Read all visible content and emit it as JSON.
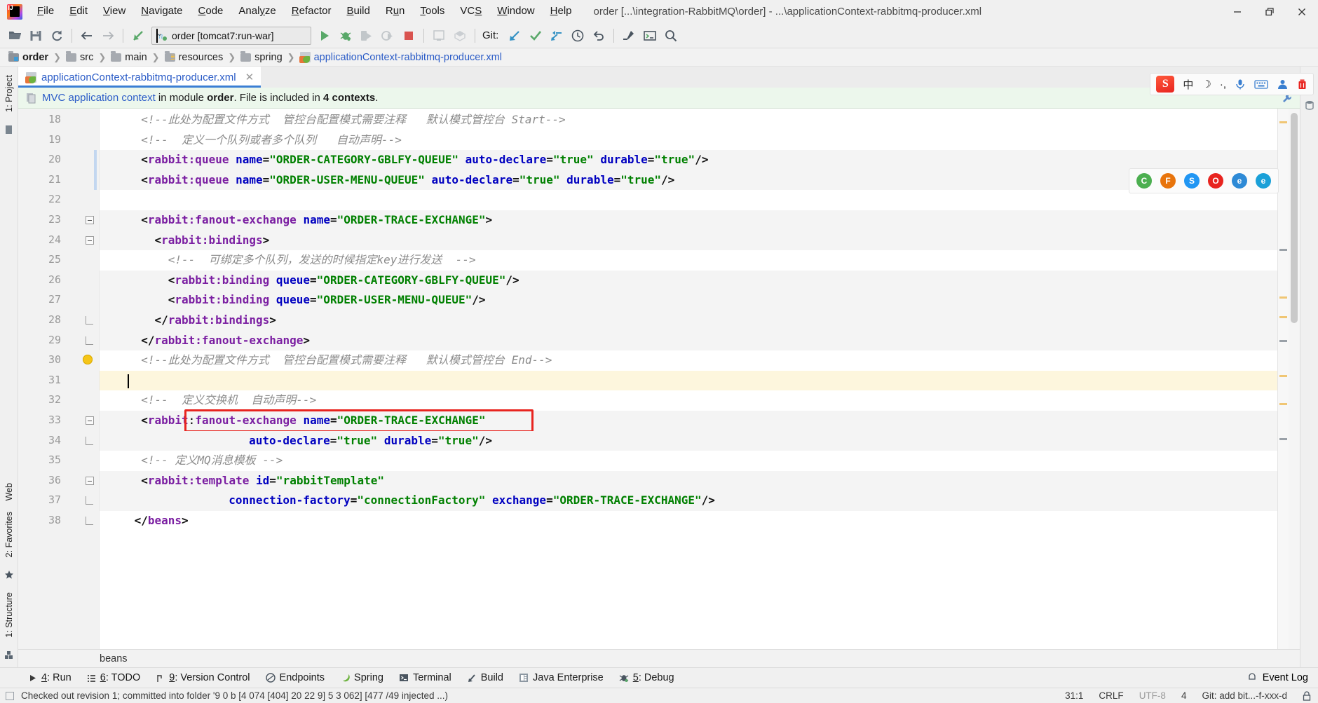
{
  "window": {
    "title": "order [...\\integration-RabbitMQ\\order] - ...\\applicationContext-rabbitmq-producer.xml",
    "minimize": "—",
    "maximize": "❐",
    "close": "✕"
  },
  "menubar": [
    {
      "label": "File",
      "accel": "F"
    },
    {
      "label": "Edit",
      "accel": "E"
    },
    {
      "label": "View",
      "accel": "V"
    },
    {
      "label": "Navigate",
      "accel": "N"
    },
    {
      "label": "Code",
      "accel": "C"
    },
    {
      "label": "Analyze",
      "accel": "y"
    },
    {
      "label": "Refactor",
      "accel": "R"
    },
    {
      "label": "Build",
      "accel": "B"
    },
    {
      "label": "Run",
      "accel": "u"
    },
    {
      "label": "Tools",
      "accel": "T"
    },
    {
      "label": "VCS",
      "accel": "S"
    },
    {
      "label": "Window",
      "accel": "W"
    },
    {
      "label": "Help",
      "accel": "H"
    }
  ],
  "toolbar": {
    "open_title": "Open",
    "save_title": "Save All",
    "sync_title": "Synchronize",
    "back_title": "Back",
    "forward_title": "Forward",
    "revert_title": "Revert",
    "run_config": "order [tomcat7:run-war]",
    "run_config_caret": "⌄",
    "run_title": "Run",
    "debug_title": "Debug",
    "run_coverage_title": "Run with Coverage",
    "profile_title": "Profile",
    "stop_title": "Stop",
    "git_label": "Git:",
    "update_title": "Update Project",
    "commit_title": "Commit",
    "push_title": "Push",
    "history_title": "History",
    "rollback_title": "Rollback",
    "settings_title": "Settings",
    "project_structure_title": "Project Structure",
    "run_anything_title": "Run Anything",
    "search_title": "Search Everywhere"
  },
  "breadcrumb": [
    {
      "label": "order",
      "icon": "project-folder-icon",
      "bold": true
    },
    {
      "label": "src",
      "icon": "folder-icon",
      "bold": false
    },
    {
      "label": "main",
      "icon": "folder-icon",
      "bold": false
    },
    {
      "label": "resources",
      "icon": "resources-folder-icon",
      "bold": false
    },
    {
      "label": "spring",
      "icon": "folder-icon",
      "bold": false
    },
    {
      "label": "applicationContext-rabbitmq-producer.xml",
      "icon": "spring-xml-icon",
      "bold": false,
      "link": true
    }
  ],
  "breadcrumb_separator": "❯",
  "editor_tab": {
    "label": "applicationContext-rabbitmq-producer.xml",
    "close": "✕"
  },
  "banner": {
    "link": "MVC application context",
    "text_1": " in module ",
    "module": "order",
    "text_2": ". File is included in ",
    "contexts": "4 contexts",
    "text_3": "."
  },
  "left_tool_tabs": [
    {
      "label": "1: Project"
    },
    {
      "label": "Web"
    },
    {
      "label": "2: Favorites"
    },
    {
      "label": "1: Structure"
    }
  ],
  "editor": {
    "first_line": 18,
    "lines": [
      {
        "n": 18,
        "indent": 2,
        "type": "comment",
        "text": "<!--此处为配置文件方式  管控台配置模式需要注释   默认模式管控台 Start-->"
      },
      {
        "n": 19,
        "indent": 2,
        "type": "comment",
        "text": "<!--  定义一个队列或者多个队列   自动声明-->"
      },
      {
        "n": 20,
        "indent": 2,
        "type": "code",
        "highlight": "soft",
        "changed": true,
        "tokens": [
          [
            "punc",
            "<"
          ],
          [
            "ns",
            "rabbit:queue"
          ],
          [
            "plain",
            " "
          ],
          [
            "attr",
            "name"
          ],
          [
            "punc",
            "="
          ],
          [
            "val",
            "\"ORDER-CATEGORY-GBLFY-QUEUE\""
          ],
          [
            "plain",
            " "
          ],
          [
            "attr",
            "auto-declare"
          ],
          [
            "punc",
            "="
          ],
          [
            "val",
            "\"true\""
          ],
          [
            "plain",
            " "
          ],
          [
            "attr",
            "durable"
          ],
          [
            "punc",
            "="
          ],
          [
            "val",
            "\"true\""
          ],
          [
            "punc",
            "/>"
          ]
        ]
      },
      {
        "n": 21,
        "indent": 2,
        "type": "code",
        "highlight": "soft",
        "changed": true,
        "tokens": [
          [
            "punc",
            "<"
          ],
          [
            "ns",
            "rabbit:queue"
          ],
          [
            "plain",
            " "
          ],
          [
            "attr",
            "name"
          ],
          [
            "punc",
            "="
          ],
          [
            "val",
            "\"ORDER-USER-MENU-QUEUE\""
          ],
          [
            "plain",
            " "
          ],
          [
            "attr",
            "auto-declare"
          ],
          [
            "punc",
            "="
          ],
          [
            "val",
            "\"true\""
          ],
          [
            "plain",
            " "
          ],
          [
            "attr",
            "durable"
          ],
          [
            "punc",
            "="
          ],
          [
            "val",
            "\"true\""
          ],
          [
            "punc",
            "/>"
          ]
        ]
      },
      {
        "n": 22,
        "indent": 0,
        "type": "blank",
        "text": ""
      },
      {
        "n": 23,
        "indent": 2,
        "type": "code",
        "highlight": "soft",
        "fold": "minus",
        "tokens": [
          [
            "punc",
            "<"
          ],
          [
            "ns",
            "rabbit:fanout-exchange"
          ],
          [
            "plain",
            " "
          ],
          [
            "attr",
            "name"
          ],
          [
            "punc",
            "="
          ],
          [
            "val",
            "\"ORDER-TRACE-EXCHANGE\""
          ],
          [
            "punc",
            ">"
          ]
        ]
      },
      {
        "n": 24,
        "indent": 4,
        "type": "code",
        "highlight": "soft",
        "fold": "minus",
        "tokens": [
          [
            "punc",
            "<"
          ],
          [
            "ns",
            "rabbit:bindings"
          ],
          [
            "punc",
            ">"
          ]
        ]
      },
      {
        "n": 25,
        "indent": 6,
        "type": "comment",
        "text": "<!--  可绑定多个队列，发送的时候指定key进行发送  -->"
      },
      {
        "n": 26,
        "indent": 6,
        "type": "code",
        "highlight": "soft",
        "tokens": [
          [
            "punc",
            "<"
          ],
          [
            "ns",
            "rabbit:binding"
          ],
          [
            "plain",
            " "
          ],
          [
            "attr",
            "queue"
          ],
          [
            "punc",
            "="
          ],
          [
            "val",
            "\"ORDER-CATEGORY-GBLFY-QUEUE\""
          ],
          [
            "punc",
            "/>"
          ]
        ]
      },
      {
        "n": 27,
        "indent": 6,
        "type": "code",
        "highlight": "soft",
        "tokens": [
          [
            "punc",
            "<"
          ],
          [
            "ns",
            "rabbit:binding"
          ],
          [
            "plain",
            " "
          ],
          [
            "attr",
            "queue"
          ],
          [
            "punc",
            "="
          ],
          [
            "val",
            "\"ORDER-USER-MENU-QUEUE\""
          ],
          [
            "punc",
            "/>"
          ]
        ]
      },
      {
        "n": 28,
        "indent": 4,
        "type": "code",
        "highlight": "soft",
        "fold": "end",
        "tokens": [
          [
            "punc",
            "</"
          ],
          [
            "ns",
            "rabbit:bindings"
          ],
          [
            "punc",
            ">"
          ]
        ]
      },
      {
        "n": 29,
        "indent": 2,
        "type": "code",
        "highlight": "soft",
        "fold": "end",
        "tokens": [
          [
            "punc",
            "</"
          ],
          [
            "ns",
            "rabbit:fanout-exchange"
          ],
          [
            "punc",
            ">"
          ]
        ]
      },
      {
        "n": 30,
        "indent": 2,
        "type": "comment",
        "bulb": true,
        "text": "<!--此处为配置文件方式  管控台配置模式需要注释   默认模式管控台 End-->"
      },
      {
        "n": 31,
        "indent": 0,
        "type": "caret",
        "text": ""
      },
      {
        "n": 32,
        "indent": 2,
        "type": "comment",
        "text": "<!--  定义交换机  自动声明-->"
      },
      {
        "n": 33,
        "indent": 2,
        "type": "code",
        "highlight": "soft",
        "fold": "minus",
        "boxed": true,
        "tokens": [
          [
            "punc",
            "<"
          ],
          [
            "ns",
            "rabbit"
          ],
          [
            "plain",
            ":"
          ],
          [
            "ns",
            "fanout-exchange"
          ],
          [
            "plain",
            " "
          ],
          [
            "attr",
            "name"
          ],
          [
            "punc",
            "="
          ],
          [
            "val",
            "\"ORDER-TRACE-EXCHANGE\""
          ]
        ]
      },
      {
        "n": 34,
        "indent": 18,
        "type": "code",
        "highlight": "soft",
        "fold": "end",
        "tokens": [
          [
            "attr",
            "auto-declare"
          ],
          [
            "punc",
            "="
          ],
          [
            "val",
            "\"true\""
          ],
          [
            "plain",
            " "
          ],
          [
            "attr",
            "durable"
          ],
          [
            "punc",
            "="
          ],
          [
            "val",
            "\"true\""
          ],
          [
            "punc",
            "/>"
          ]
        ]
      },
      {
        "n": 35,
        "indent": 2,
        "type": "comment",
        "text": "<!-- 定义MQ消息模板 -->"
      },
      {
        "n": 36,
        "indent": 2,
        "type": "code",
        "highlight": "soft",
        "fold": "minus",
        "tokens": [
          [
            "punc",
            "<"
          ],
          [
            "ns",
            "rabbit:template"
          ],
          [
            "plain",
            " "
          ],
          [
            "attr",
            "id"
          ],
          [
            "punc",
            "="
          ],
          [
            "val",
            "\"rabbitTemplate\""
          ]
        ]
      },
      {
        "n": 37,
        "indent": 15,
        "type": "code",
        "highlight": "soft",
        "fold": "end",
        "tokens": [
          [
            "attr",
            "connection-factory"
          ],
          [
            "punc",
            "="
          ],
          [
            "val",
            "\"connectionFactory\""
          ],
          [
            "plain",
            " "
          ],
          [
            "attr",
            "exchange"
          ],
          [
            "punc",
            "="
          ],
          [
            "val",
            "\"ORDER-TRACE-EXCHANGE\""
          ],
          [
            "punc",
            "/>"
          ]
        ]
      },
      {
        "n": 38,
        "indent": 1,
        "type": "code",
        "fold": "end",
        "tokens": [
          [
            "punc",
            "</"
          ],
          [
            "ns",
            "beans"
          ],
          [
            "punc",
            ">"
          ]
        ]
      }
    ]
  },
  "structure_footer": "beans",
  "tool_windows": [
    {
      "num": "4",
      "label": ": Run",
      "icon": "run-icon"
    },
    {
      "num": "6",
      "label": ": TODO",
      "icon": "todo-icon"
    },
    {
      "num": "9",
      "label": ": Version Control",
      "icon": "vcs-icon"
    },
    {
      "num": "",
      "label": "Endpoints",
      "icon": "endpoints-icon"
    },
    {
      "num": "",
      "label": "Spring",
      "icon": "spring-icon"
    },
    {
      "num": "",
      "label": "Terminal",
      "icon": "terminal-icon"
    },
    {
      "num": "",
      "label": "Build",
      "icon": "build-icon"
    },
    {
      "num": "",
      "label": "Java Enterprise",
      "icon": "java-ee-icon"
    },
    {
      "num": "5",
      "label": ": Debug",
      "icon": "debug-icon"
    }
  ],
  "event_log": {
    "label": "Event Log",
    "icon": "event-log-icon"
  },
  "status_bar": {
    "message": "Checked out revision 1; committed into folder '9 0 b  [4 074  [404] 20 22  9]  5 3 062]  [477 /49  injected ...)",
    "position": "31:1",
    "line_sep": "CRLF",
    "encoding": "UTF-8",
    "indent": "4",
    "branch": "Git: add bit...-f-xxx-d",
    "lock_icon": "lock-icon"
  },
  "ime": {
    "logo": "S",
    "items": [
      "中",
      "☽",
      "·,",
      "mic-icon",
      "keyboard-icon",
      "tools-icon",
      "trash-icon"
    ]
  },
  "browser_icons": [
    {
      "name": "chrome-icon",
      "color": "#4caf50",
      "glyph": "C"
    },
    {
      "name": "firefox-icon",
      "color": "#e8740c",
      "glyph": "F"
    },
    {
      "name": "safari-icon",
      "color": "#2196f3",
      "glyph": "S"
    },
    {
      "name": "opera-icon",
      "color": "#e8241f",
      "glyph": "O"
    },
    {
      "name": "edge-icon",
      "color": "#2e8ad6",
      "glyph": "e"
    },
    {
      "name": "ie-icon",
      "color": "#1aa0d8",
      "glyph": "e"
    }
  ],
  "colors": {
    "accent": "#2b5cc7",
    "tab_underline": "#3b7fd4",
    "banner_bg": "#ecf7ec",
    "redbox": "#e8241f",
    "xml_value": "#008000",
    "xml_attr": "#0000c0",
    "xml_ns": "#7b1fa2",
    "comment": "#8c8c8c"
  }
}
